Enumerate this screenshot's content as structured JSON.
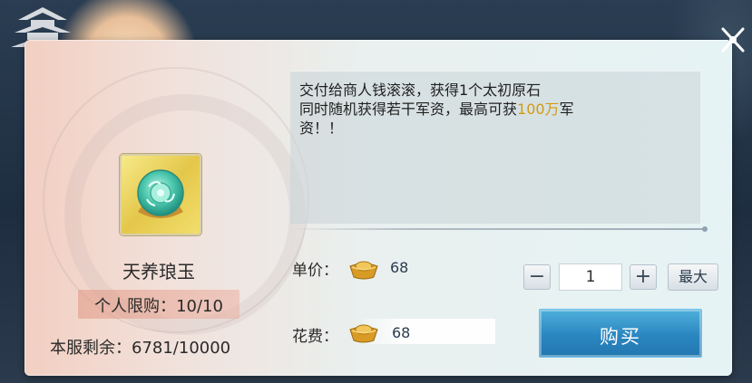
{
  "item": {
    "name": "天养琅玉",
    "icon": "jade-disc-icon",
    "limit_label": "个人限购：",
    "limit_value": "10/10",
    "remaining_label": "本服剩余：",
    "remaining_value": "6781/10000"
  },
  "description": {
    "line1": "交付给商人钱滚滚，获得1个太初原石",
    "line2_prefix": "同时随机获得若干军资，最高可获",
    "highlight": "100万",
    "line2_suffix": "军",
    "line3": "资！！",
    "highlight_color": "#d29a10"
  },
  "unit_price": {
    "label": "单价：",
    "currency_icon": "gold-ingot-icon",
    "value": "68"
  },
  "cost": {
    "label": "花费：",
    "currency_icon": "gold-ingot-icon",
    "value": "68"
  },
  "quantity": {
    "minus": "−",
    "value": "1",
    "plus": "+",
    "max_label": "最大"
  },
  "buy_button": {
    "label": "购买",
    "color": "#2b86c0"
  },
  "close_icon": "close-icon"
}
